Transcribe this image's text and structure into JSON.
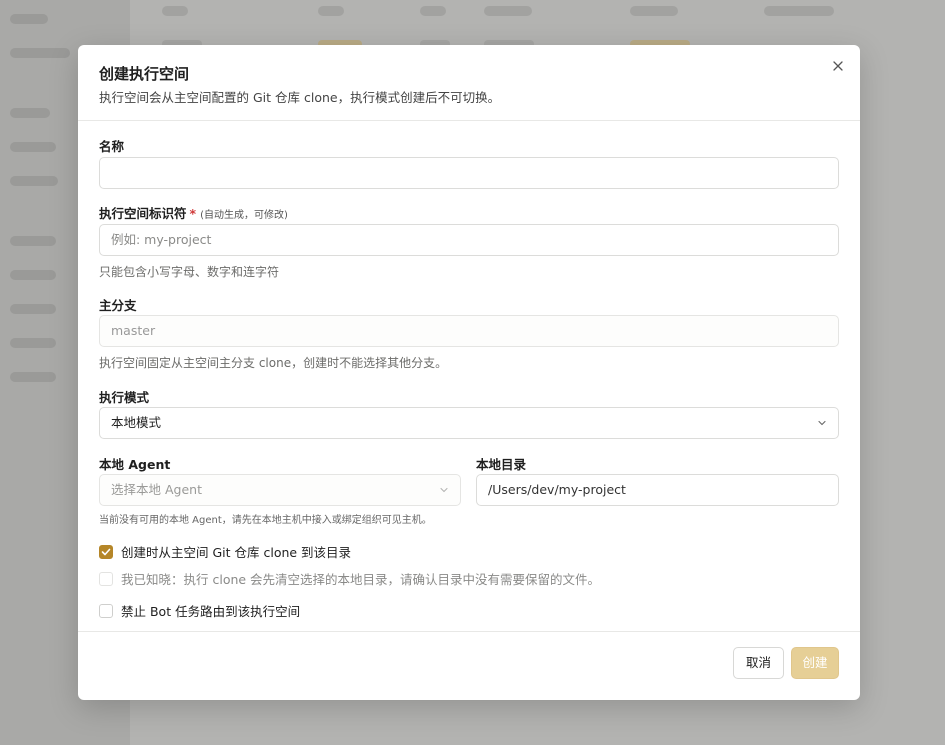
{
  "dialog": {
    "title": "创建执行空间",
    "description": "执行空间会从主空间配置的 Git 仓库 clone，执行模式创建后不可切换。"
  },
  "fields": {
    "name": {
      "label": "名称",
      "value": ""
    },
    "slug": {
      "label": "执行空间标识符",
      "required_mark": "*",
      "hint": "(自动生成，可修改)",
      "placeholder": "例如: my-project",
      "help": "只能包含小写字母、数字和连字符"
    },
    "branch": {
      "label": "主分支",
      "value": "master",
      "help": "执行空间固定从主空间主分支 clone，创建时不能选择其他分支。"
    },
    "mode": {
      "label": "执行模式",
      "selected": "本地模式"
    },
    "agent": {
      "label": "本地 Agent",
      "placeholder": "选择本地 Agent"
    },
    "directory": {
      "label": "本地目录",
      "value": "/Users/dev/my-project"
    },
    "agent_help": "当前没有可用的本地 Agent，请先在本地主机中接入或绑定组织可见主机。"
  },
  "checkboxes": [
    {
      "label": "创建时从主空间 Git 仓库 clone 到该目录",
      "checked": true,
      "enabled": true
    },
    {
      "label": "我已知晓：执行 clone 会先清空选择的本地目录，请确认目录中没有需要保留的文件。",
      "checked": false,
      "enabled": false
    },
    {
      "label": "禁止 Bot 任务路由到该执行空间",
      "checked": false,
      "enabled": true
    }
  ],
  "footer": {
    "cancel_label": "取消",
    "create_label": "创建"
  },
  "colors": {
    "accent": "#b58628",
    "accent_disabled": "#e6cf96",
    "required": "#d03a3a"
  }
}
